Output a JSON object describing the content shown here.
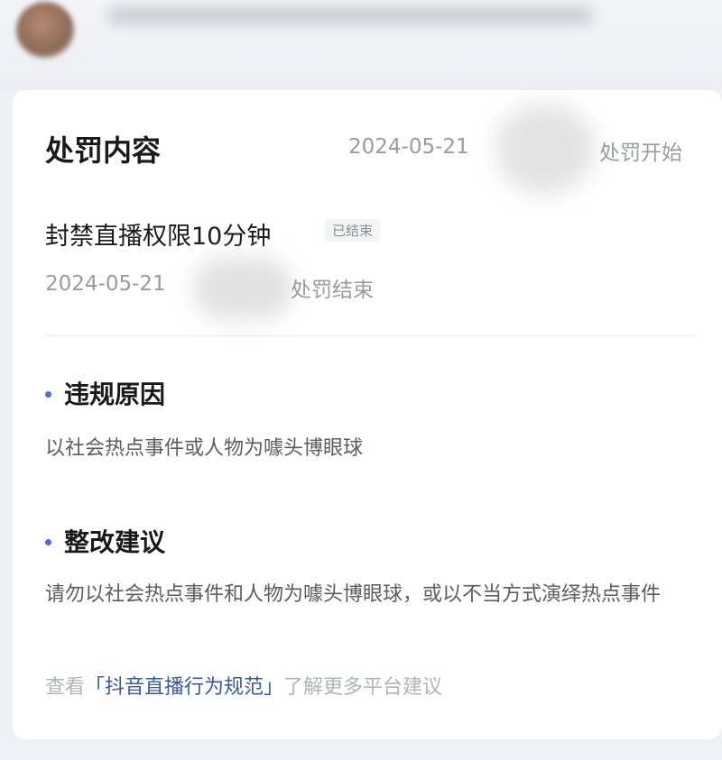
{
  "card": {
    "title": "处罚内容",
    "start_date": "2024-05-21",
    "start_label": "处罚开始",
    "penalty": "封禁直播权限10分钟",
    "status_badge": "已结束",
    "end_date": "2024-05-21",
    "end_label": "处罚结束",
    "violation_title": "违规原因",
    "violation_text": "以社会热点事件或人物为噱头博眼球",
    "suggestion_title": "整改建议",
    "suggestion_text": "请勿以社会热点事件和人物为噱头博眼球，或以不当方式演绎热点事件",
    "more_prefix": "查看",
    "more_link": "「抖音直播行为规范」",
    "more_suffix": "了解更多平台建议"
  },
  "colors": {
    "accent": "#4d6be0",
    "link": "#3b5a9c",
    "muted": "#9a9ba0"
  }
}
